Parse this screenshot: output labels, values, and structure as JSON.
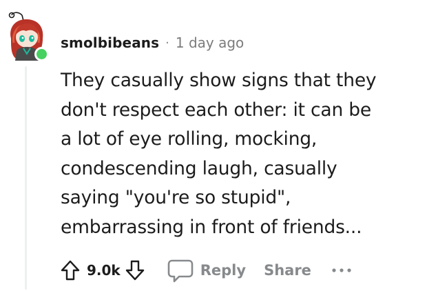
{
  "comment": {
    "username": "smolbibeans",
    "separator": "·",
    "timestamp": "1 day ago",
    "body_lines": [
      "They casually show signs that they",
      "don't respect each other: it can be",
      "a lot of eye rolling, mocking,",
      "condescending laugh, casually",
      "saying \"you're so stupid\",",
      "embarrassing in front of friends..."
    ],
    "score": "9.0k",
    "reply_label": "Reply",
    "share_label": "Share"
  },
  "colors": {
    "online_indicator": "#46d160",
    "avatar_hair": "#c0392b",
    "avatar_face_accent": "#1abc9c",
    "muted_text": "#878a8c",
    "thread_line": "#edeff1"
  },
  "icons": {
    "upvote": "arrow-up-icon",
    "downvote": "arrow-down-icon",
    "reply": "speech-bubble-icon",
    "more": "ellipsis-icon"
  }
}
